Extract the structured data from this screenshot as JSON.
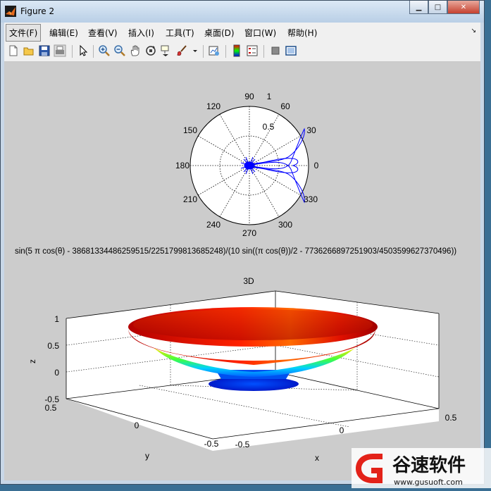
{
  "window": {
    "title": "Figure 2",
    "minimize_glyph": "▁",
    "maximize_glyph": "□",
    "close_glyph": "✕"
  },
  "menu": {
    "items": [
      {
        "label": "文件(F)"
      },
      {
        "label": "编辑(E)"
      },
      {
        "label": "查看(V)"
      },
      {
        "label": "插入(I)"
      },
      {
        "label": "工具(T)"
      },
      {
        "label": "桌面(D)"
      },
      {
        "label": "窗口(W)"
      },
      {
        "label": "帮助(H)"
      }
    ],
    "overflow_glyph": "↘"
  },
  "toolbar": {
    "buttons": [
      "new-figure-icon",
      "open-file-icon",
      "save-icon",
      "print-icon",
      "edit-plot-arrow-icon",
      "zoom-in-icon",
      "zoom-out-icon",
      "pan-hand-icon",
      "rotate-3d-icon",
      "data-cursor-icon",
      "brush-icon",
      "brush-dropdown-icon",
      "link-plot-icon",
      "insert-colorbar-icon",
      "insert-legend-icon",
      "hide-plot-tools-icon",
      "show-plot-tools-icon"
    ]
  },
  "polar_plot": {
    "angle_labels": [
      "0",
      "30",
      "60",
      "90",
      "120",
      "150",
      "180",
      "210",
      "240",
      "270",
      "300",
      "330"
    ],
    "radius_labels": [
      "0.5",
      "1"
    ],
    "line_color": "#0000ff",
    "title": "sin(5 π cos(θ) - 3868133448625951​5/2251799813685248)/(10 sin((π cos(θ))/2 - 7736266897251903/4503599627370496))"
  },
  "surface_plot": {
    "title": "3D",
    "x_label": "x",
    "y_label": "y",
    "z_label": "z",
    "x_ticks": [
      "-0.5",
      "0",
      "0.5"
    ],
    "y_ticks": [
      "-0.5",
      "0",
      "0.5"
    ],
    "z_ticks": [
      "-0.5",
      "0",
      "0.5",
      "1"
    ]
  },
  "watermark": {
    "brand": "谷速软件",
    "url": "www.gusuoft.com"
  }
}
